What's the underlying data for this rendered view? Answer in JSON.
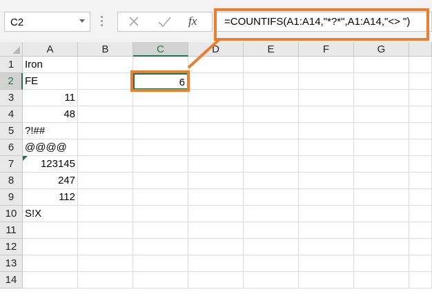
{
  "formula_bar": {
    "name_box": "C2",
    "formula": "=COUNTIFS(A1:A14,\"*?*\",A1:A14,\"<> \")",
    "cancel_icon": "close-icon",
    "enter_icon": "checkmark-icon",
    "fx_label": "fx"
  },
  "columns": [
    "A",
    "B",
    "C",
    "D",
    "E",
    "F",
    "G"
  ],
  "rows": [
    "1",
    "2",
    "3",
    "4",
    "5",
    "6",
    "7",
    "8",
    "9",
    "10",
    "11",
    "12",
    "13",
    "14"
  ],
  "cells": {
    "A1": "Iron",
    "A2": "FE",
    "A3": "11",
    "A4": "48",
    "A5": "?!##",
    "A6": "@@@@",
    "A7": "123145",
    "A8": "247",
    "A9": "112",
    "A10": "S!X",
    "C2": "6"
  },
  "selection": {
    "active_cell": "C2",
    "active_column": "C",
    "active_row": "2"
  },
  "colors": {
    "highlight": "#ED7D31",
    "excel_green": "#217346"
  }
}
